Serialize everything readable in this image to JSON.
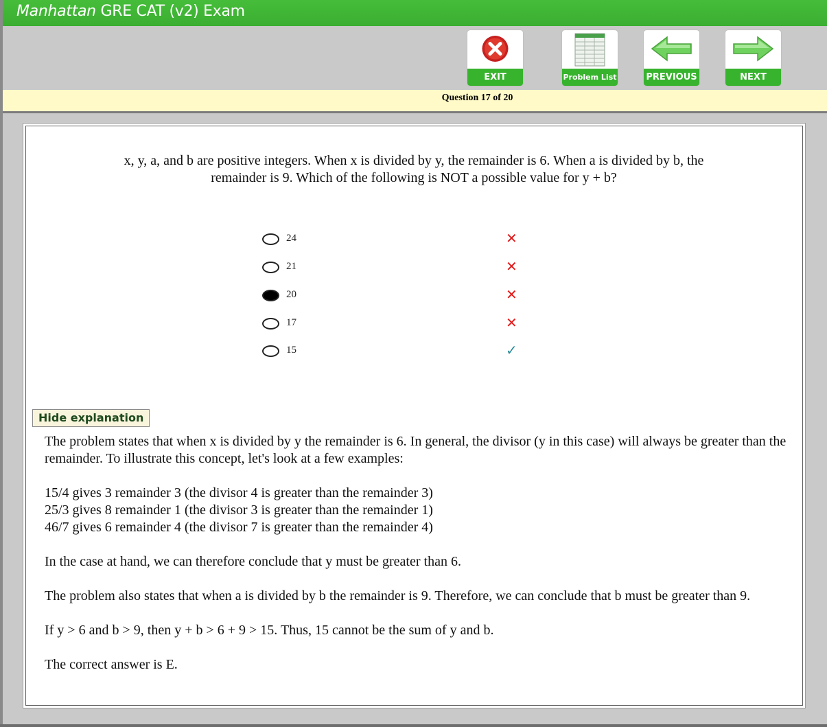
{
  "app": {
    "title_brand": "Manhattan",
    "title_rest": " GRE CAT (v2) Exam"
  },
  "toolbar": {
    "exit_label": "EXIT",
    "problem_list_label": "Problem List",
    "previous_label": "PREVIOUS",
    "next_label": "NEXT"
  },
  "status": {
    "question_counter": "Question 17 of 20"
  },
  "question": {
    "line1": "x, y, a, and b are positive integers.  When x is divided by y, the remainder is 6.  When a is divided by b, the",
    "line2": "remainder is 9.  Which of the following is NOT a possible value for y + b?"
  },
  "choices": [
    {
      "label": "24",
      "selected": false,
      "result": "incorrect",
      "mark": "✕"
    },
    {
      "label": "21",
      "selected": false,
      "result": "incorrect",
      "mark": "✕"
    },
    {
      "label": "20",
      "selected": true,
      "result": "incorrect",
      "mark": "✕"
    },
    {
      "label": "17",
      "selected": false,
      "result": "incorrect",
      "mark": "✕"
    },
    {
      "label": "15",
      "selected": false,
      "result": "correct",
      "mark": "✓"
    }
  ],
  "explanation": {
    "toggle_label": "Hide explanation",
    "p1": "The problem states that when x is divided by y the remainder is 6.  In general, the divisor (y in this case) will always be greater than the remainder.  To illustrate this concept, let's look at a few examples:",
    "ex1": "15/4 gives 3 remainder 3 (the divisor 4 is greater than the remainder 3)",
    "ex2": "25/3 gives 8 remainder 1 (the divisor 3 is greater than the remainder 1)",
    "ex3": "46/7 gives 6 remainder 4 (the divisor 7 is greater than the remainder 4)",
    "p2": "In the case at hand, we can therefore conclude that y must be greater than 6.",
    "p3": "The problem also states that when a is divided by b the remainder is 9.  Therefore, we can conclude that b must be greater than 9.",
    "p4": "If y > 6 and b > 9, then y + b > 6 + 9 > 15.  Thus, 15 cannot be the sum of y and b.",
    "p5": "The correct answer is E."
  },
  "colors": {
    "brand_green": "#3aae31",
    "status_bar": "#fffac8",
    "wrong_mark": "#e41b1b",
    "right_mark": "#2a8a98"
  }
}
